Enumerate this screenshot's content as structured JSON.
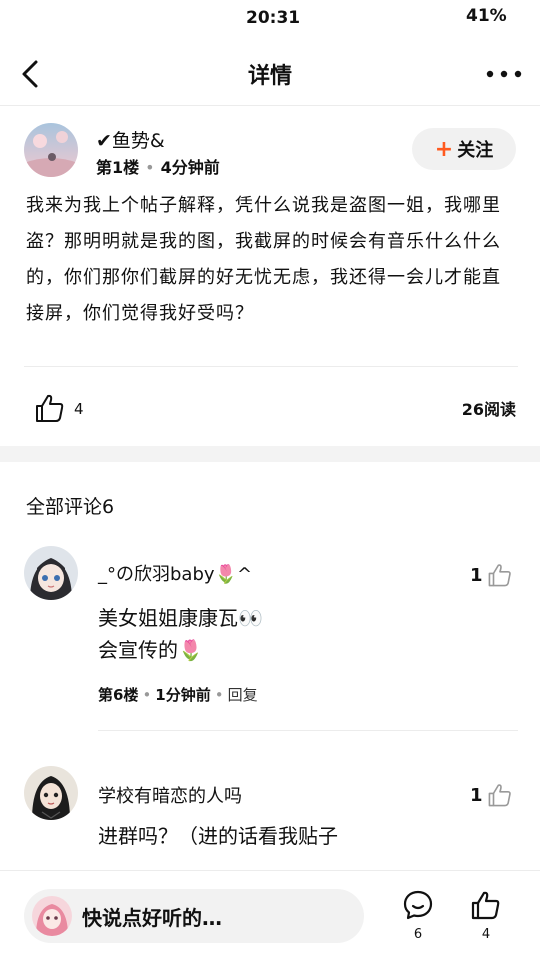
{
  "status_bar": {
    "time": "20:31",
    "battery": "41%"
  },
  "header": {
    "title": "详情"
  },
  "post": {
    "author": "✔鱼势&",
    "floor": "第1楼",
    "time_ago": "4分钟前",
    "follow_label": "关注",
    "body": "我来为我上个帖子解释，凭什么说我是盗图一姐，我哪里盗？那明明就是我的图，我截屏的时候会有音乐什么什么的，你们那你们截屏的好无忧无虑，我还得一会儿才能直接屏，你们觉得我好受吗？",
    "like_count": "4",
    "read_count": "26阅读"
  },
  "comments_section": {
    "title": "全部评论6"
  },
  "comments": [
    {
      "name": "_°の欣羽baby🌷^",
      "like_count": "1",
      "lines": [
        "美女姐姐康康瓦👀",
        "会宣传的🌷"
      ],
      "floor": "第6楼",
      "time_ago": "1分钟前",
      "reply_label": "回复"
    },
    {
      "name": "学校有暗恋的人吗",
      "like_count": "1",
      "lines": [
        "进群吗？（进的话看我贴子"
      ]
    }
  ],
  "bottom_bar": {
    "input_placeholder": "快说点好听的…",
    "comment_count": "6",
    "like_count": "4"
  },
  "colors": {
    "accent": "#ff5a1f",
    "divider": "#ececec",
    "section_gap": "#f3f3f3"
  }
}
